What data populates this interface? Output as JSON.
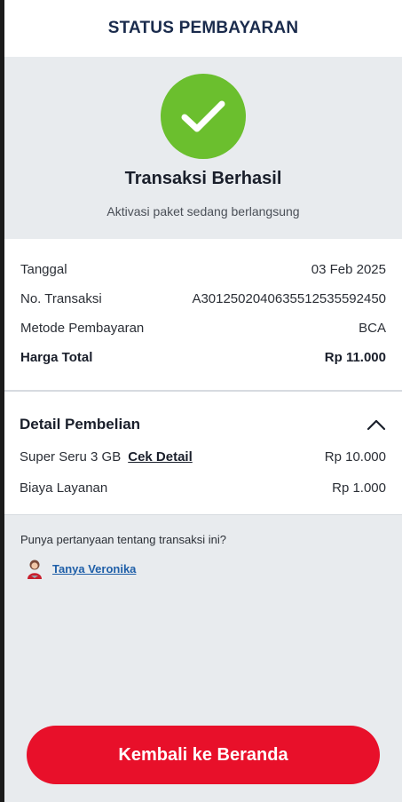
{
  "header": {
    "title": "STATUS PEMBAYARAN"
  },
  "status": {
    "icon": "check-icon",
    "title": "Transaksi Berhasil",
    "subtitle": "Aktivasi paket sedang berlangsung",
    "color": "#6bbf2e"
  },
  "transaction": {
    "rows": [
      {
        "label": "Tanggal",
        "value": "03 Feb 2025"
      },
      {
        "label": "No. Transaksi",
        "value": "A3012502040635512535592450"
      },
      {
        "label": "Metode Pembayaran",
        "value": "BCA"
      },
      {
        "label": "Harga Total",
        "value": "Rp 11.000"
      }
    ]
  },
  "detail": {
    "title": "Detail Pembelian",
    "items": [
      {
        "label": "Super Seru 3 GB",
        "link": "Cek Detail",
        "value": "Rp 10.000"
      },
      {
        "label": "Biaya Layanan",
        "value": "Rp 1.000"
      }
    ]
  },
  "help": {
    "question": "Punya pertanyaan tentang transaksi ini?",
    "link": "Tanya Veronika"
  },
  "cta": {
    "label": "Kembali ke Beranda",
    "color": "#e8102a"
  }
}
